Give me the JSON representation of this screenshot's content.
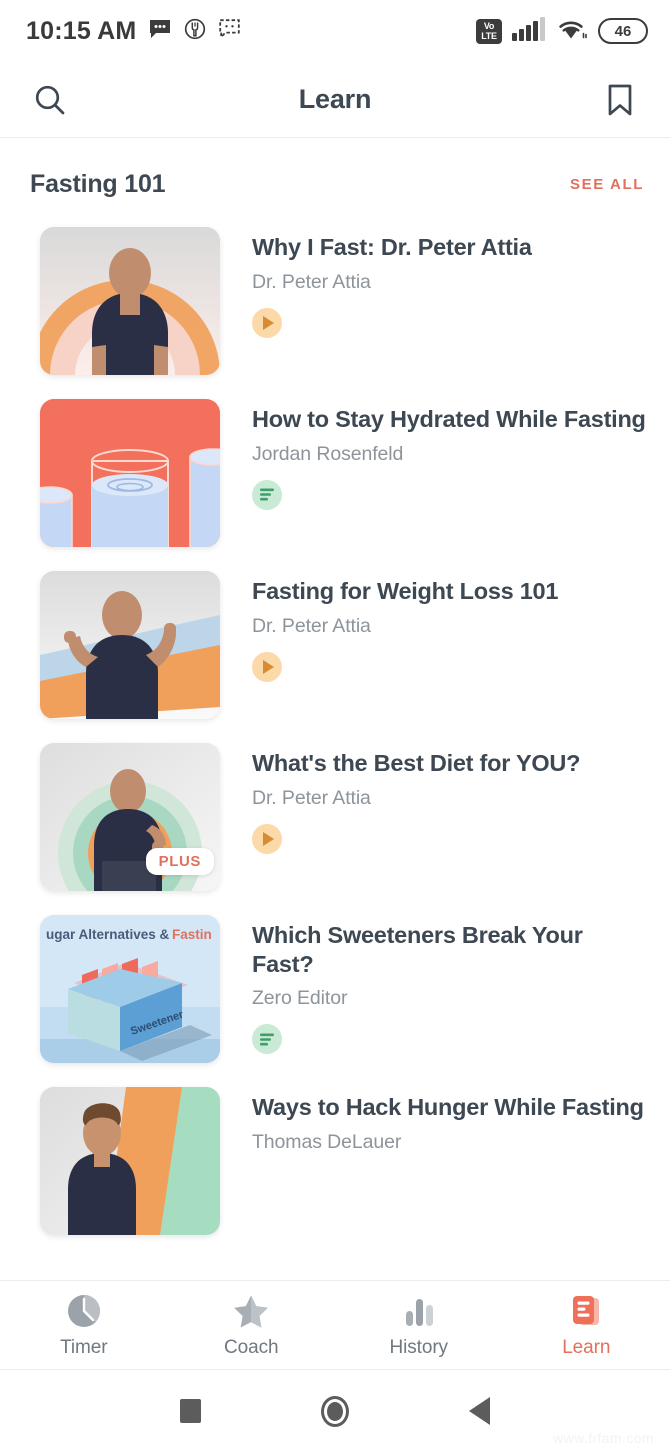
{
  "status_bar": {
    "time": "10:15 AM",
    "left_icons": [
      "message-bubble-icon",
      "food-fork-icon",
      "chat-repeat-icon"
    ],
    "network_label_top": "Vo",
    "network_label_bottom": "LTE",
    "signal_icon": "cellular-signal-icon",
    "wifi_icon": "wifi-icon",
    "battery_level": "46"
  },
  "header": {
    "title": "Learn",
    "search_icon": "search-icon",
    "bookmark_icon": "bookmark-icon"
  },
  "section": {
    "title": "Fasting 101",
    "see_all_label": "SEE ALL"
  },
  "colors": {
    "accent": "#e2705e",
    "title_text": "#3d4852",
    "subtitle_text": "#8d949b",
    "video_badge_bg": "#fbd9a8",
    "video_badge_fg": "#d98b33",
    "article_badge_bg": "#c9ead5",
    "article_badge_fg": "#3f9e6b",
    "thumb_hydration_bg": "#f2705c",
    "thumb_sweetener_bg": "#cfe4f5"
  },
  "cards": [
    {
      "title": "Why I Fast: Dr. Peter Attia",
      "author": "Dr. Peter Attia",
      "type": "video",
      "type_icon": "play-icon",
      "thumb": "portrait-rainbow-arcs",
      "plus": false
    },
    {
      "title": "How to Stay Hydrated While Fasting",
      "author": "Jordan Rosenfeld",
      "type": "article",
      "type_icon": "article-lines-icon",
      "thumb": "water-glasses",
      "plus": false
    },
    {
      "title": "Fasting for Weight Loss 101",
      "author": "Dr. Peter Attia",
      "type": "video",
      "type_icon": "play-icon",
      "thumb": "portrait-diagonal-bands",
      "plus": false
    },
    {
      "title": "What's the Best Diet for YOU?",
      "author": "Dr. Peter Attia",
      "type": "video",
      "type_icon": "play-icon",
      "thumb": "portrait-concentric-rings",
      "plus": true,
      "plus_label": "PLUS"
    },
    {
      "title": "Which Sweeteners Break Your Fast?",
      "author": "Zero Editor",
      "type": "article",
      "type_icon": "article-lines-icon",
      "thumb": "sweetener-box",
      "thumb_text_top": "ugar Alternatives & Fastin",
      "thumb_text_box": "Sweetener",
      "plus": false
    },
    {
      "title": "Ways to Hack Hunger While Fasting",
      "author": "Thomas DeLauer",
      "type": "none",
      "thumb": "portrait-orange-green-bands",
      "plus": false
    }
  ],
  "tabs": [
    {
      "label": "Timer",
      "icon": "timer-clock-icon",
      "active": false
    },
    {
      "label": "Coach",
      "icon": "star-icon",
      "active": false
    },
    {
      "label": "History",
      "icon": "bar-chart-icon",
      "active": false
    },
    {
      "label": "Learn",
      "icon": "book-document-icon",
      "active": true
    }
  ],
  "android_nav": {
    "recent_icon": "recent-apps-square-icon",
    "home_icon": "home-circle-icon",
    "back_icon": "back-triangle-icon"
  },
  "watermark": "www.frfam.com"
}
